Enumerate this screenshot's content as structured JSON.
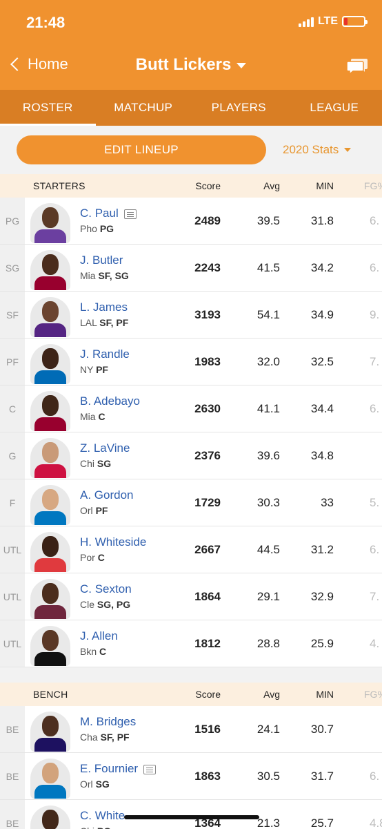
{
  "status": {
    "time": "21:48",
    "network": "LTE"
  },
  "nav": {
    "back_label": "Home",
    "title": "Butt Lickers"
  },
  "tabs": [
    {
      "label": "ROSTER",
      "active": true
    },
    {
      "label": "MATCHUP",
      "active": false
    },
    {
      "label": "PLAYERS",
      "active": false
    },
    {
      "label": "LEAGUE",
      "active": false
    }
  ],
  "actions": {
    "edit_lineup_label": "EDIT LINEUP",
    "stats_selector": "2020 Stats"
  },
  "columns": {
    "score": "Score",
    "avg": "Avg",
    "min": "MIN",
    "fg": "FG%"
  },
  "starters": {
    "label": "STARTERS",
    "rows": [
      {
        "slot": "PG",
        "name": "C. Paul",
        "team": "Pho",
        "pos": "PG",
        "score": "2489",
        "avg": "39.5",
        "min": "31.8",
        "fg": "6."
      },
      {
        "slot": "SG",
        "name": "J. Butler",
        "team": "Mia",
        "pos": "SF, SG",
        "score": "2243",
        "avg": "41.5",
        "min": "34.2",
        "fg": "6."
      },
      {
        "slot": "SF",
        "name": "L. James",
        "team": "LAL",
        "pos": "SF, PF",
        "score": "3193",
        "avg": "54.1",
        "min": "34.9",
        "fg": "9."
      },
      {
        "slot": "PF",
        "name": "J. Randle",
        "team": "NY",
        "pos": "PF",
        "score": "1983",
        "avg": "32.0",
        "min": "32.5",
        "fg": "7."
      },
      {
        "slot": "C",
        "name": "B. Adebayo",
        "team": "Mia",
        "pos": "C",
        "score": "2630",
        "avg": "41.1",
        "min": "34.4",
        "fg": "6."
      },
      {
        "slot": "G",
        "name": "Z. LaVine",
        "team": "Chi",
        "pos": "SG",
        "score": "2376",
        "avg": "39.6",
        "min": "34.8",
        "fg": ""
      },
      {
        "slot": "F",
        "name": "A. Gordon",
        "team": "Orl",
        "pos": "PF",
        "score": "1729",
        "avg": "30.3",
        "min": "33",
        "fg": "5."
      },
      {
        "slot": "UTL",
        "name": "H. Whiteside",
        "team": "Por",
        "pos": "C",
        "score": "2667",
        "avg": "44.5",
        "min": "31.2",
        "fg": "6."
      },
      {
        "slot": "UTL",
        "name": "C. Sexton",
        "team": "Cle",
        "pos": "SG, PG",
        "score": "1864",
        "avg": "29.1",
        "min": "32.9",
        "fg": "7."
      },
      {
        "slot": "UTL",
        "name": "J. Allen",
        "team": "Bkn",
        "pos": "C",
        "score": "1812",
        "avg": "28.8",
        "min": "25.9",
        "fg": "4."
      }
    ]
  },
  "bench": {
    "label": "BENCH",
    "rows": [
      {
        "slot": "BE",
        "name": "M. Bridges",
        "team": "Cha",
        "pos": "SF, PF",
        "score": "1516",
        "avg": "24.1",
        "min": "30.7",
        "fg": ""
      },
      {
        "slot": "BE",
        "name": "E. Fournier",
        "team": "Orl",
        "pos": "SG",
        "score": "1863",
        "avg": "30.5",
        "min": "31.7",
        "fg": "6."
      },
      {
        "slot": "BE",
        "name": "C. White",
        "team": "Chi",
        "pos": "PG",
        "score": "1364",
        "avg": "21.3",
        "min": "25.7",
        "fg": "4.8"
      }
    ]
  },
  "news_icon_players": [
    "C. Paul",
    "E. Fournier"
  ],
  "colors": {
    "brand_orange": "#f0922f",
    "tab_bar": "#d97e24",
    "link_blue": "#2f5fae",
    "section_bg": "#fcefdf"
  }
}
